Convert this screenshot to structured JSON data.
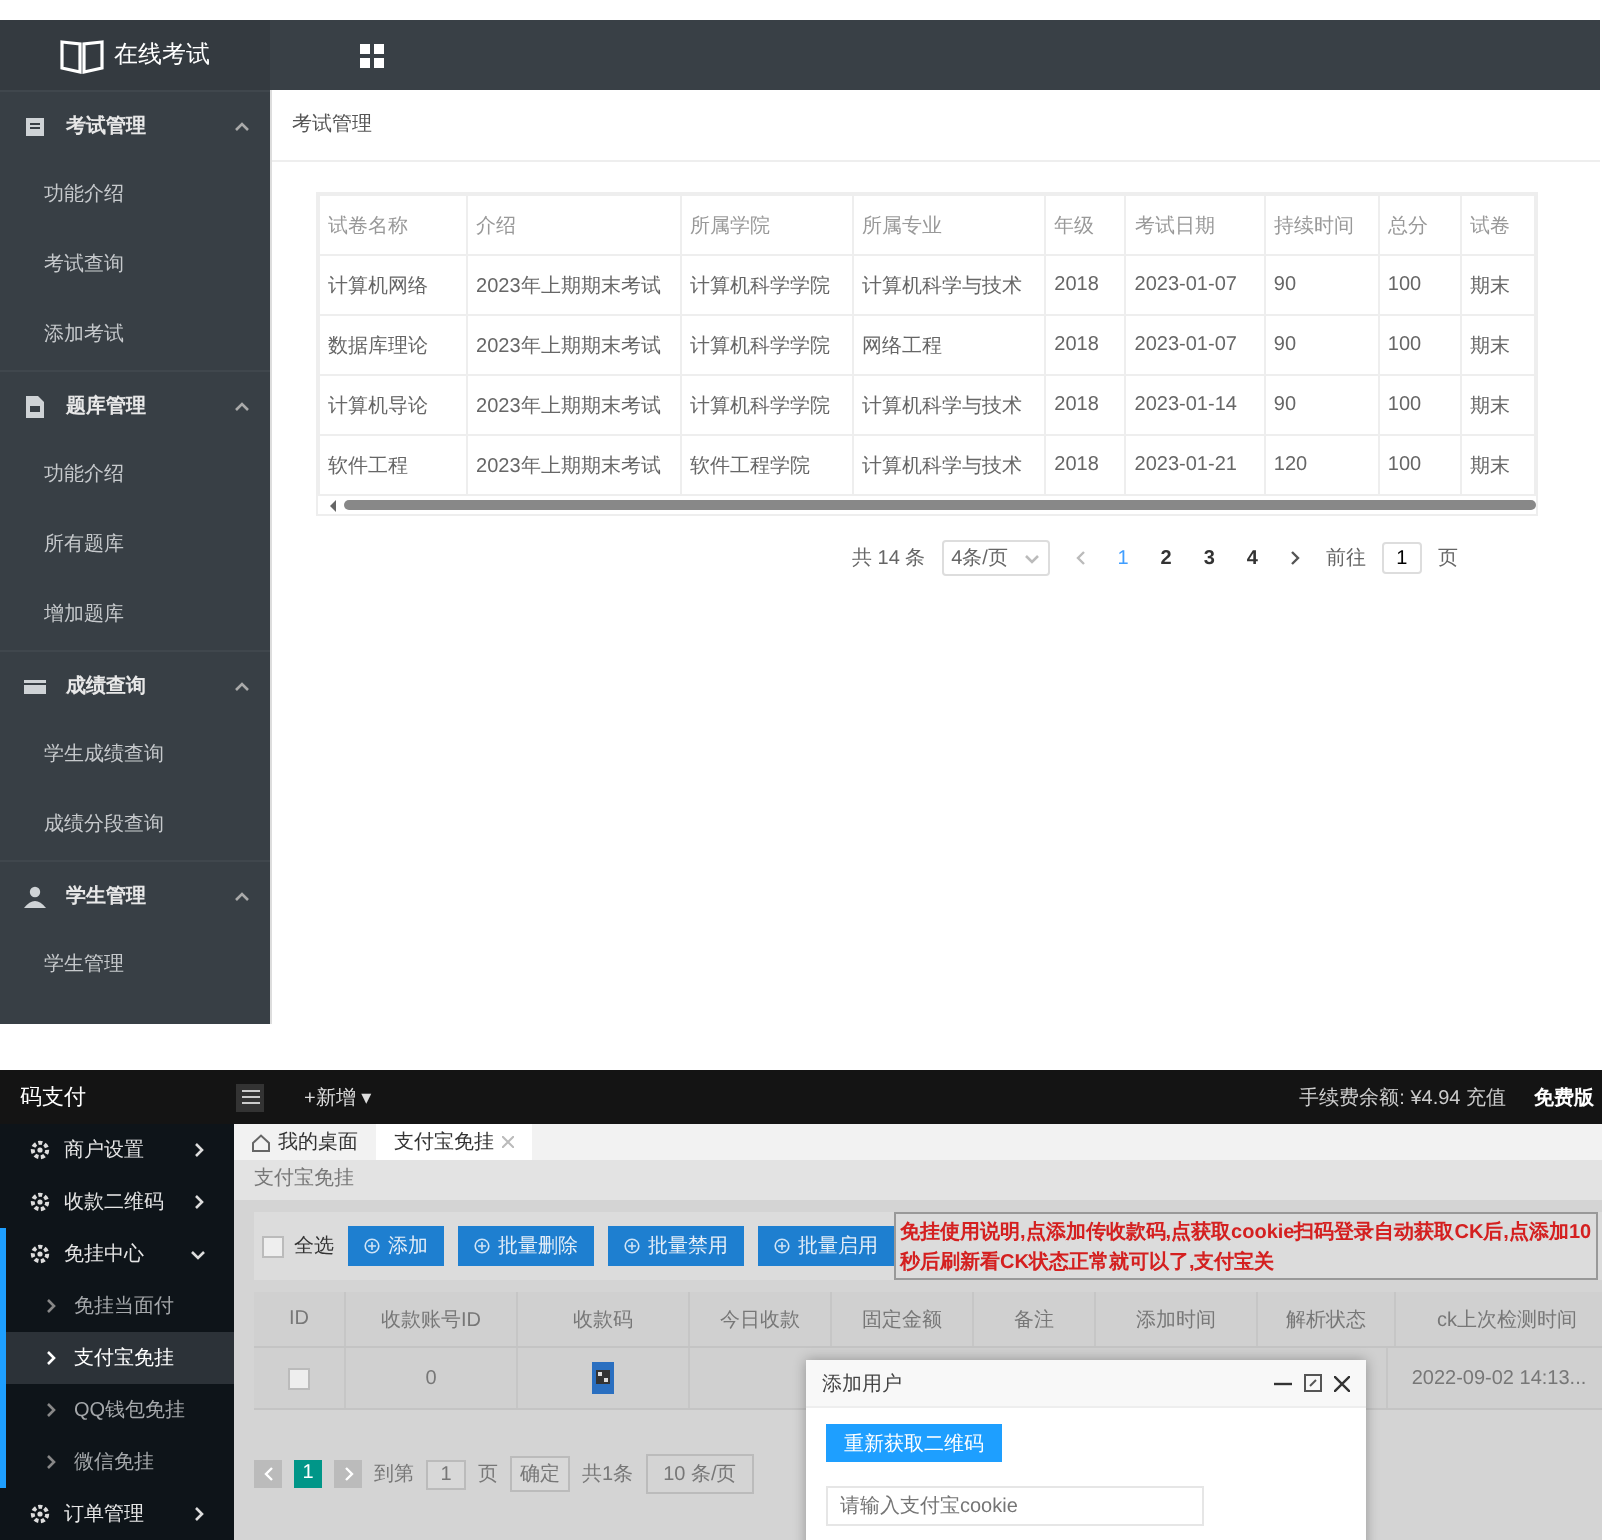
{
  "exam_app": {
    "logo": "在线考试",
    "sidebar": [
      {
        "title": "考试管理",
        "expanded": true,
        "children": [
          {
            "label": "功能介绍"
          },
          {
            "label": "考试查询"
          },
          {
            "label": "添加考试"
          }
        ]
      },
      {
        "title": "题库管理",
        "expanded": true,
        "children": [
          {
            "label": "功能介绍"
          },
          {
            "label": "所有题库"
          },
          {
            "label": "增加题库"
          }
        ]
      },
      {
        "title": "成绩查询",
        "expanded": true,
        "children": [
          {
            "label": "学生成绩查询"
          },
          {
            "label": "成绩分段查询"
          }
        ]
      },
      {
        "title": "学生管理",
        "expanded": true,
        "children": [
          {
            "label": "学生管理"
          }
        ]
      }
    ],
    "breadcrumb": "考试管理",
    "table": {
      "columns": [
        "试卷名称",
        "介绍",
        "所属学院",
        "所属专业",
        "年级",
        "考试日期",
        "持续时间",
        "总分",
        "试卷"
      ],
      "rows": [
        [
          "计算机网络",
          "2023年上期期末考试",
          "计算机科学学院",
          "计算机科学与技术",
          "2018",
          "2023-01-07",
          "90",
          "100",
          "期末"
        ],
        [
          "数据库理论",
          "2023年上期期末考试",
          "计算机科学学院",
          "网络工程",
          "2018",
          "2023-01-07",
          "90",
          "100",
          "期末"
        ],
        [
          "计算机导论",
          "2023年上期期末考试",
          "计算机科学学院",
          "计算机科学与技术",
          "2018",
          "2023-01-14",
          "90",
          "100",
          "期末"
        ],
        [
          "软件工程",
          "2023年上期期末考试",
          "软件工程学院",
          "计算机科学与技术",
          "2018",
          "2023-01-21",
          "120",
          "100",
          "期末"
        ]
      ]
    },
    "pagination": {
      "total": "共 14 条",
      "page_size": "4条/页",
      "pages": [
        {
          "label": "1",
          "selected": true
        },
        {
          "label": "2",
          "selected": false
        },
        {
          "label": "3",
          "selected": false
        },
        {
          "label": "4",
          "selected": false
        }
      ],
      "goto_label": "前往",
      "goto_value": "1",
      "goto_suffix": "页"
    }
  },
  "pay_app": {
    "logo": "码支付",
    "new_menu": "+新增 ▾",
    "balance": "手续费余额: ¥4.94 充值",
    "edition": "免费版",
    "sidebar": [
      {
        "label": "商户设置",
        "expanded": false
      },
      {
        "label": "收款二维码",
        "expanded": false
      },
      {
        "label": "免挂中心",
        "expanded": true,
        "children": [
          {
            "label": "免挂当面付",
            "selected": false
          },
          {
            "label": "支付宝免挂",
            "selected": true
          },
          {
            "label": "QQ钱包免挂",
            "selected": false
          },
          {
            "label": "微信免挂",
            "selected": false
          }
        ]
      },
      {
        "label": "订单管理",
        "expanded": false
      }
    ],
    "tabs": [
      {
        "label": "我的桌面",
        "selected": false,
        "closable": false
      },
      {
        "label": "支付宝免挂",
        "selected": true,
        "closable": true
      }
    ],
    "breadcrumb": "支付宝免挂",
    "select_all": {
      "label": "全选",
      "checked": false
    },
    "buttons": [
      "添加",
      "批量删除",
      "批量禁用",
      "批量启用"
    ],
    "notice": "免挂使用说明,点添加传收款码,点获取cookie扫码登录自动获取CK后,点添加10秒后刷新看CK状态正常就可以了,支付宝关",
    "table": {
      "columns": [
        "ID",
        "收款账号ID",
        "收款码",
        "今日收款",
        "固定金额",
        "备注",
        "添加时间",
        "解析状态",
        "ck上次检测时间"
      ],
      "rows": [
        {
          "checked": false,
          "account_id": "0",
          "last_check": "2022-09-02 14:13..."
        }
      ]
    },
    "pagination": {
      "pages": [
        {
          "label": "1",
          "selected": true
        }
      ],
      "goto_label": "到第",
      "goto_value": "1",
      "goto_suffix": "页",
      "confirm": "确定",
      "total": "共1条",
      "page_size": "10 条/页"
    },
    "dialog": {
      "title": "添加用户",
      "refresh_button": "重新获取二维码",
      "cookie_placeholder": "请输入支付宝cookie"
    }
  }
}
